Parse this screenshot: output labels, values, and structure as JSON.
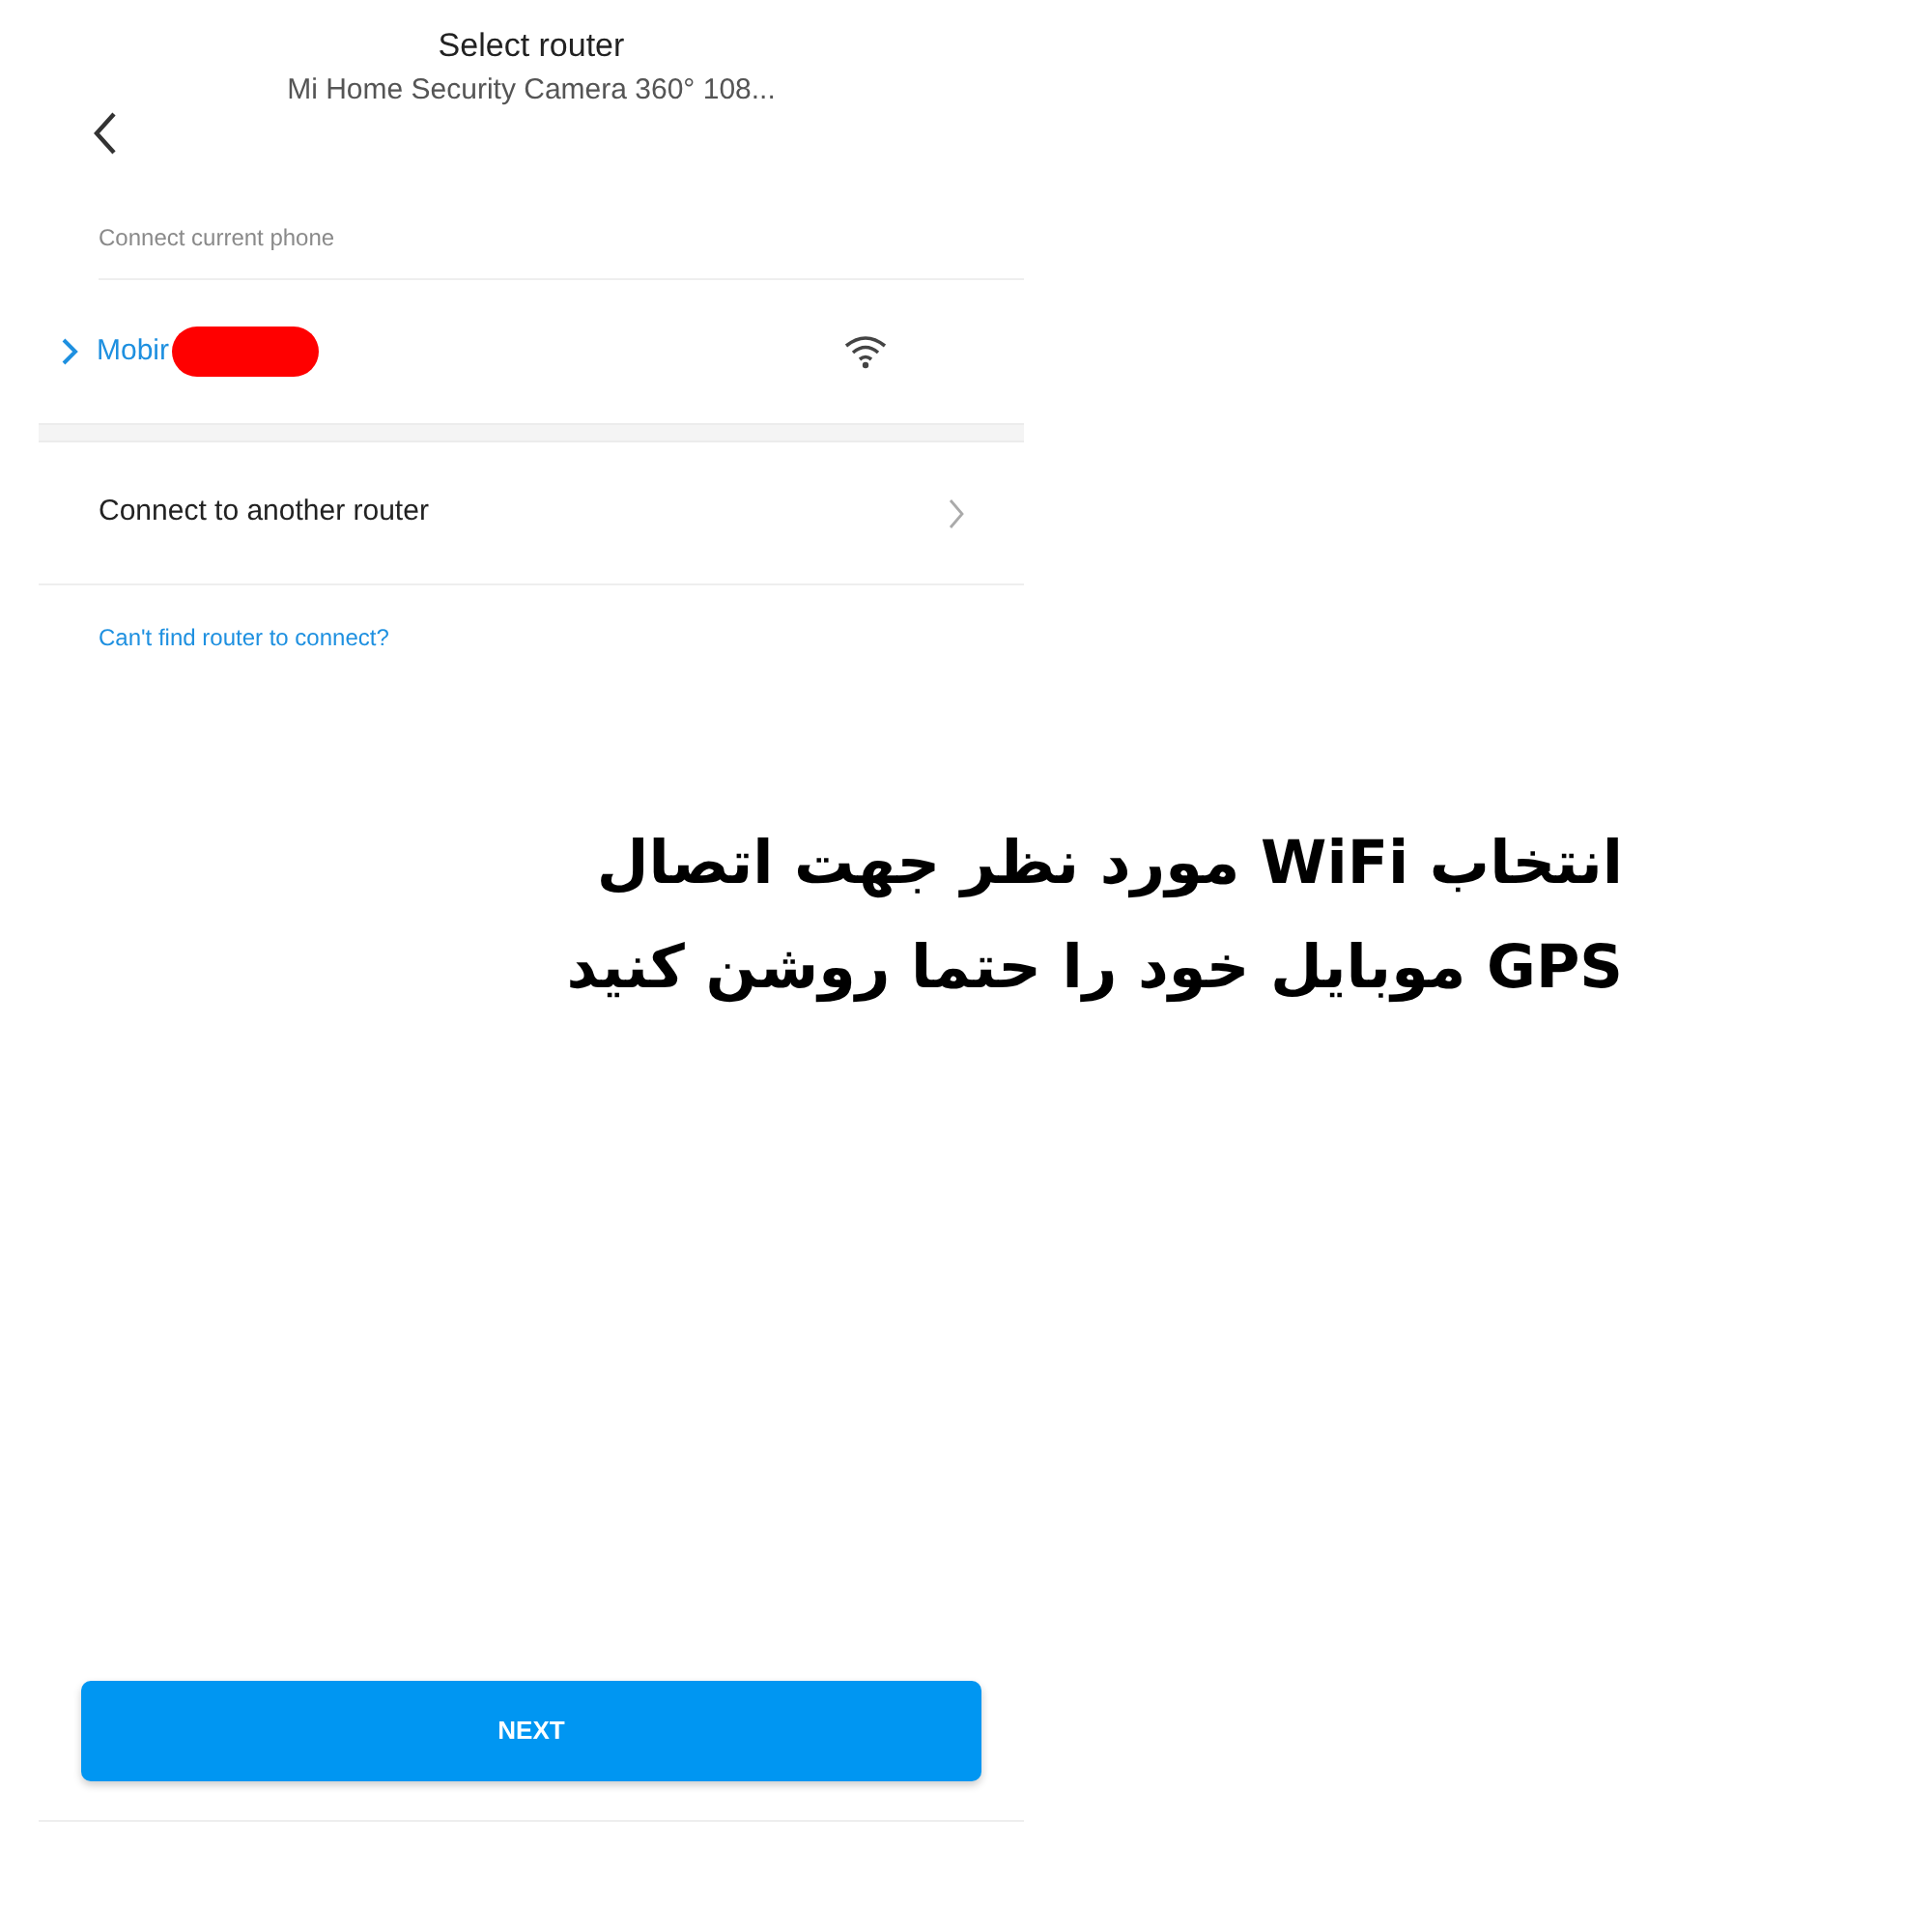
{
  "header": {
    "title": "Select router",
    "subtitle": "Mi Home Security Camera 360° 108..."
  },
  "section_label": "Connect current phone",
  "networks": [
    {
      "name": "Mobir",
      "selected": true,
      "redacted": true
    }
  ],
  "other_router": {
    "label": "Connect to another router"
  },
  "help_link": "Can't find router to connect?",
  "next_button": "NEXT",
  "caption": [
    "انتخاب  WiFi  مورد نظر جهت اتصال",
    "GPS موبایل خود را حتما روشن کنید"
  ]
}
